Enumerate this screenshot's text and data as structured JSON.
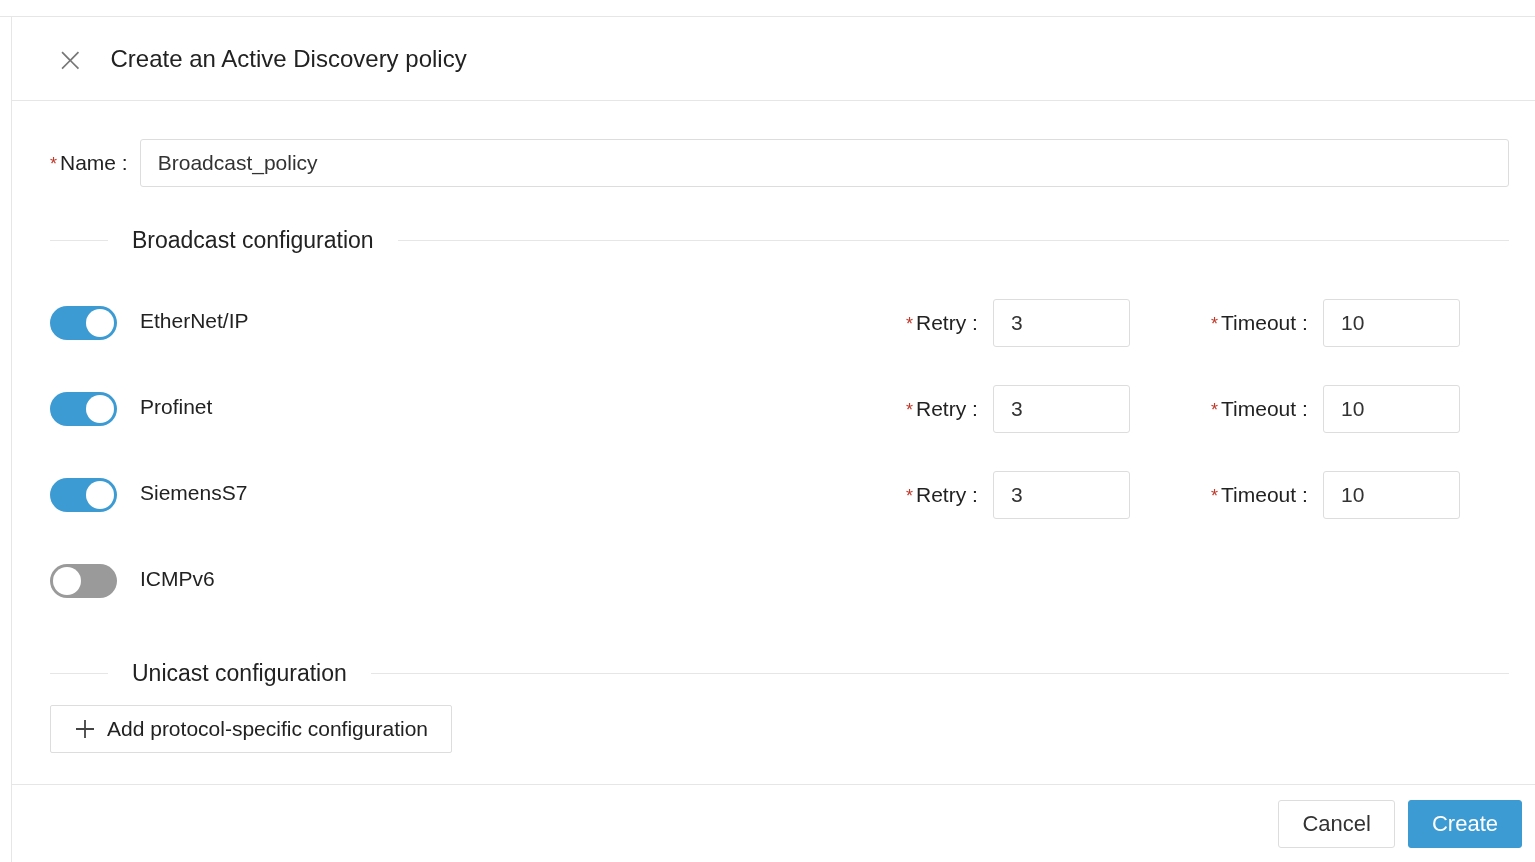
{
  "dialog": {
    "close": "×",
    "title": "Create an Active Discovery policy"
  },
  "name_field": {
    "mark": "*",
    "label": "Name :",
    "value": "Broadcast_policy"
  },
  "broadcast": {
    "heading": "Broadcast configuration",
    "protocols": [
      {
        "label": "EtherNet/IP",
        "on": true,
        "retry": {
          "mark": "*",
          "label": "Retry :",
          "value": "3"
        },
        "timeout": {
          "mark": "*",
          "label": "Timeout :",
          "value": "10"
        }
      },
      {
        "label": "Profinet",
        "on": true,
        "retry": {
          "mark": "*",
          "label": "Retry :",
          "value": "3"
        },
        "timeout": {
          "mark": "*",
          "label": "Timeout :",
          "value": "10"
        }
      },
      {
        "label": "SiemensS7",
        "on": true,
        "retry": {
          "mark": "*",
          "label": "Retry :",
          "value": "3"
        },
        "timeout": {
          "mark": "*",
          "label": "Timeout :",
          "value": "10"
        }
      },
      {
        "label": "ICMPv6",
        "on": false
      }
    ]
  },
  "unicast": {
    "heading": "Unicast configuration",
    "add_button": "Add protocol-specific configuration"
  },
  "buttons": [
    {
      "label": "Cancel",
      "kind": "secondary"
    },
    {
      "label": "Create",
      "kind": "primary"
    }
  ]
}
